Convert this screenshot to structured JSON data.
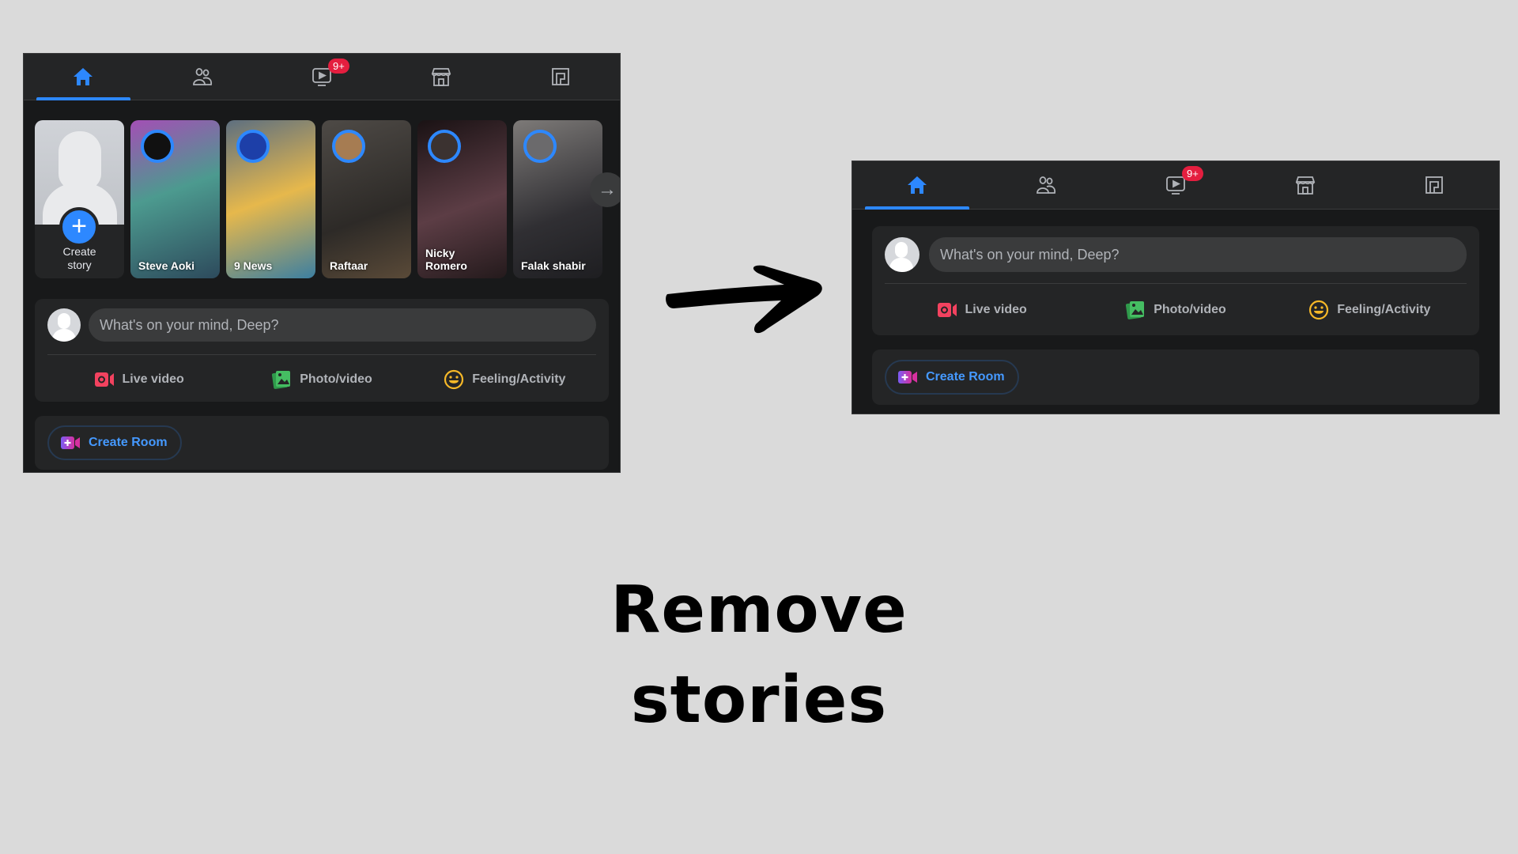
{
  "before": {
    "tabs": [
      {
        "name": "home",
        "icon": "home-icon",
        "active": true
      },
      {
        "name": "friends",
        "icon": "friends-icon",
        "active": false
      },
      {
        "name": "watch",
        "icon": "watch-icon",
        "active": false,
        "badge": "9+"
      },
      {
        "name": "marketplace",
        "icon": "marketplace-icon",
        "active": false
      },
      {
        "name": "gaming",
        "icon": "gaming-icon",
        "active": false
      }
    ],
    "stories": {
      "create_label_line1": "Create",
      "create_label_line2": "story",
      "items": [
        {
          "name": "Steve Aoki"
        },
        {
          "name": "9 News"
        },
        {
          "name": "Raftaar"
        },
        {
          "name": "Nicky Romero"
        },
        {
          "name": "Falak shabir"
        }
      ],
      "next_icon": "→"
    },
    "composer": {
      "placeholder": "What's on your mind, Deep?",
      "actions": [
        {
          "label": "Live video",
          "icon": "live-video-icon",
          "color": "#f3425f"
        },
        {
          "label": "Photo/video",
          "icon": "photo-video-icon",
          "color": "#45bd62"
        },
        {
          "label": "Feeling/Activity",
          "icon": "feeling-icon",
          "color": "#f7b928"
        }
      ]
    },
    "room": {
      "label": "Create Room"
    }
  },
  "after": {
    "tabs": [
      {
        "name": "home",
        "icon": "home-icon",
        "active": true
      },
      {
        "name": "friends",
        "icon": "friends-icon",
        "active": false
      },
      {
        "name": "watch",
        "icon": "watch-icon",
        "active": false,
        "badge": "9+"
      },
      {
        "name": "marketplace",
        "icon": "marketplace-icon",
        "active": false
      },
      {
        "name": "gaming",
        "icon": "gaming-icon",
        "active": false
      }
    ],
    "composer": {
      "placeholder": "What's on your mind, Deep?",
      "actions": [
        {
          "label": "Live video",
          "icon": "live-video-icon",
          "color": "#f3425f"
        },
        {
          "label": "Photo/video",
          "icon": "photo-video-icon",
          "color": "#45bd62"
        },
        {
          "label": "Feeling/Activity",
          "icon": "feeling-icon",
          "color": "#f7b928"
        }
      ]
    },
    "room": {
      "label": "Create Room"
    }
  },
  "caption": {
    "line1": "Remove",
    "line2": "stories"
  },
  "colors": {
    "accent": "#2d88ff",
    "badge": "#e41e3f",
    "room_text": "#4599ff"
  }
}
